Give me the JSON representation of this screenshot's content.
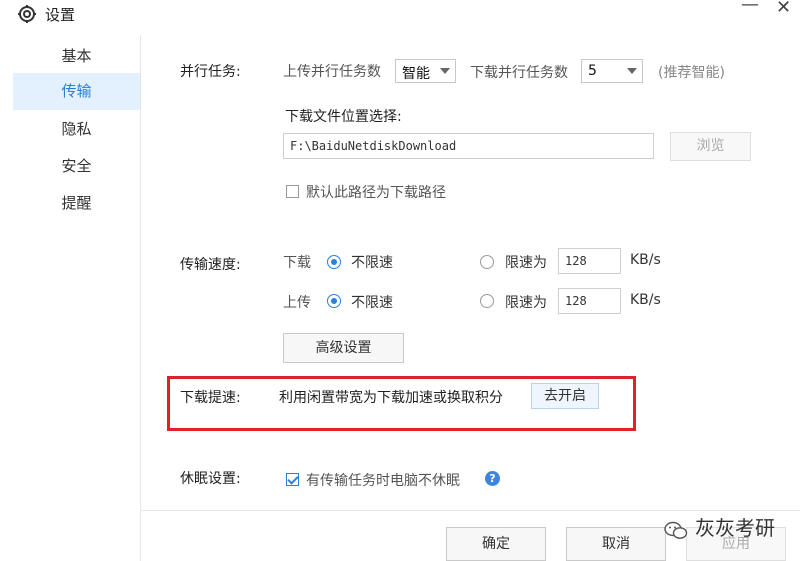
{
  "window": {
    "title": "设置",
    "icon": "gear-icon",
    "minimize_glyph": "—",
    "close_glyph": "✕"
  },
  "sidebar": {
    "items": [
      {
        "label": "基本",
        "active": false
      },
      {
        "label": "传输",
        "active": true
      },
      {
        "label": "隐私",
        "active": false
      },
      {
        "label": "安全",
        "active": false
      },
      {
        "label": "提醒",
        "active": false
      }
    ]
  },
  "parallel": {
    "label": "并行任务:",
    "upload_label": "上传并行任务数",
    "upload_value": "智能",
    "download_label": "下载并行任务数",
    "download_value": "5",
    "hint": "(推荐智能)"
  },
  "download_location": {
    "label": "下载文件位置选择:",
    "path": "F:\\BaiduNetdiskDownload",
    "browse_label": "浏览",
    "default_checkbox_label": "默认此路径为下载路径",
    "default_checked": false
  },
  "speed": {
    "label": "传输速度:",
    "download": {
      "label": "下载",
      "unlimited_label": "不限速",
      "unlimited_checked": true,
      "limit_label": "限速为",
      "limit_value": "128",
      "unit": "KB/s"
    },
    "upload": {
      "label": "上传",
      "unlimited_label": "不限速",
      "unlimited_checked": true,
      "limit_label": "限速为",
      "limit_value": "128",
      "unit": "KB/s"
    },
    "advanced_label": "高级设置"
  },
  "boost": {
    "label": "下载提速:",
    "description": "利用闲置带宽为下载加速或换取积分",
    "enable_label": "去开启",
    "highlight_color": "#e0202a"
  },
  "sleep": {
    "label": "休眠设置:",
    "checkbox_label": "有传输任务时电脑不休眠",
    "checked": true,
    "help_icon": "question-icon",
    "help_glyph": "?"
  },
  "footer": {
    "ok_label": "确定",
    "cancel_label": "取消",
    "apply_label": "应用"
  },
  "watermark": {
    "text": "灰灰考研",
    "icon": "wechat-icon"
  },
  "colors": {
    "accent": "#2f7ed8",
    "active_bg": "#e3f0fd"
  }
}
